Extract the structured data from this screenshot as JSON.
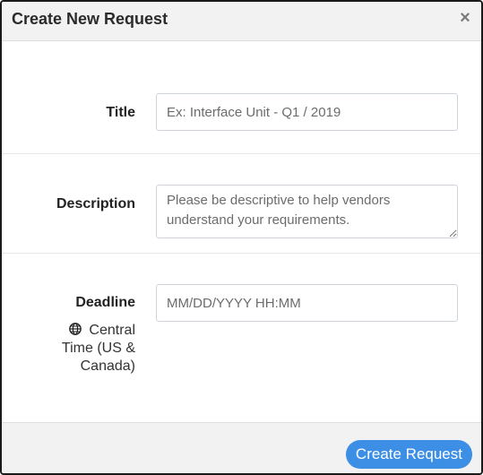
{
  "modal": {
    "title": "Create New Request",
    "close_symbol": "×"
  },
  "form": {
    "title": {
      "label": "Title",
      "placeholder": "Ex: Interface Unit - Q1 / 2019",
      "value": ""
    },
    "description": {
      "label": "Description",
      "placeholder": "Please be descriptive to help vendors understand your requirements.",
      "value": ""
    },
    "deadline": {
      "label": "Deadline",
      "placeholder": "MM/DD/YYYY HH:MM",
      "value": "",
      "timezone_icon": "globe-icon",
      "timezone": "Central Time (US & Canada)"
    }
  },
  "footer": {
    "submit_label": "Create Request"
  },
  "colors": {
    "primary_button": "#3d8fe6",
    "header_bg": "#f2f2f2"
  }
}
